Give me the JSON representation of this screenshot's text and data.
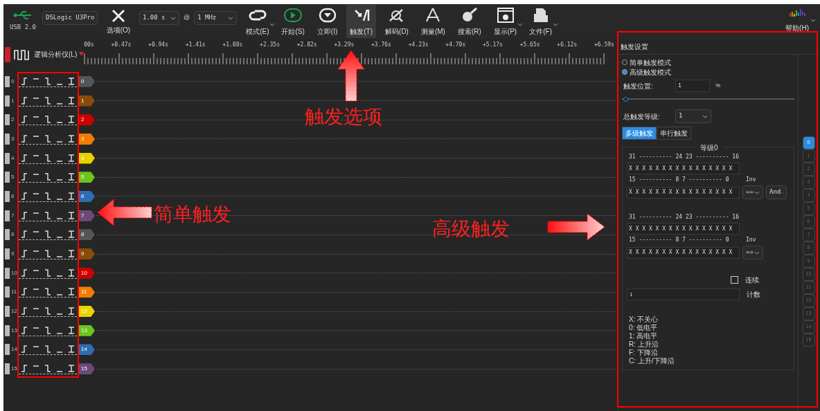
{
  "toolbar": {
    "usb_label": "USB 2.0",
    "device": "DSLogic U3Pro",
    "duration": "1.00 s",
    "at": "@",
    "rate": "1 MHz",
    "buttons": [
      {
        "kind": "options",
        "label": "选项(O)",
        "selected": false
      },
      {
        "kind": "mode",
        "label": "模式(E)",
        "selected": false,
        "menu": true
      },
      {
        "kind": "start",
        "label": "开始(S)",
        "selected": false
      },
      {
        "kind": "instant",
        "label": "立即(I)",
        "selected": false
      },
      {
        "kind": "trigger",
        "label": "触发(T)",
        "selected": true
      },
      {
        "kind": "decode",
        "label": "解码(D)",
        "selected": false
      },
      {
        "kind": "measure",
        "label": "测量(M)",
        "selected": false
      },
      {
        "kind": "search",
        "label": "搜索(R)",
        "selected": false
      },
      {
        "kind": "display",
        "label": "显示(P)",
        "selected": false,
        "menu": true
      },
      {
        "kind": "file",
        "label": "文件(F)",
        "selected": false,
        "menu": true
      }
    ],
    "help": {
      "label": "帮助(H)"
    }
  },
  "ruler": {
    "title": "逻辑分析仪(L)",
    "ticks": [
      "00s",
      "+0.47s",
      "+0.94s",
      "+1.41s",
      "+1.88s",
      "+2.35s",
      "+2.82s",
      "+3.29s",
      "+3.76s",
      "+4.23s",
      "+4.70s",
      "+5.17s",
      "+5.65s",
      "+6.12s",
      "+6.59s"
    ]
  },
  "channels": [
    {
      "index": "0",
      "tag": "0",
      "color": "#555555"
    },
    {
      "index": "1",
      "tag": "1",
      "color": "#8a4b08"
    },
    {
      "index": "2",
      "tag": "2",
      "color": "#cc0000"
    },
    {
      "index": "3",
      "tag": "3",
      "color": "#f27c00"
    },
    {
      "index": "4",
      "tag": "4",
      "color": "#e8d300"
    },
    {
      "index": "5",
      "tag": "5",
      "color": "#6cc51c"
    },
    {
      "index": "6",
      "tag": "6",
      "color": "#2e6db4"
    },
    {
      "index": "7",
      "tag": "7",
      "color": "#6b4a7a"
    },
    {
      "index": "8",
      "tag": "8",
      "color": "#555555"
    },
    {
      "index": "9",
      "tag": "9",
      "color": "#8a4b08"
    },
    {
      "index": "10",
      "tag": "10",
      "color": "#cc0000"
    },
    {
      "index": "11",
      "tag": "11",
      "color": "#f27c00"
    },
    {
      "index": "12",
      "tag": "12",
      "color": "#e8d300"
    },
    {
      "index": "13",
      "tag": "13",
      "color": "#6cc51c"
    },
    {
      "index": "14",
      "tag": "14",
      "color": "#2e6db4"
    },
    {
      "index": "15",
      "tag": "15",
      "color": "#6b4a7a"
    }
  ],
  "trigger_panel": {
    "title": "触发设置",
    "modes": [
      {
        "label": "简单触发模式",
        "selected": false
      },
      {
        "label": "高级触发模式",
        "selected": true
      }
    ],
    "position_label": "触发位置:",
    "position_value": "1",
    "position_unit": "%",
    "position_slider": {
      "level": 0.01
    },
    "stages_label": "总触发等级:",
    "stages_value": "1",
    "tabs": [
      {
        "label": "多级触发",
        "selected": true
      },
      {
        "label": "串行触发",
        "selected": false
      }
    ],
    "stage_title": "等级0",
    "conditions": [
      {
        "high_bits": "31 ---------- 24 23 ---------- 16",
        "high_value": "X X X X X X X X X X X X X X X X",
        "low_bits": "15 ---------- 8 7 ---------- 0",
        "inv_label": "Inv",
        "low_value": "X X X X X X X X X X X X X X X X",
        "compare": "==",
        "logic": "And"
      },
      {
        "high_bits": "31 ---------- 24 23 ---------- 16",
        "high_value": "X X X X X X X X X X X X X X X X",
        "low_bits": "15 ---------- 8 7 ---------- 0",
        "inv_label": "Inv",
        "low_value": "X X X X X X X X X X X X X X X X",
        "compare": "=="
      }
    ],
    "continuous": {
      "label": "连续",
      "checked": false
    },
    "count_value": "1",
    "count_label": "计数",
    "legend": [
      "X: 不关心",
      "0: 低电平",
      "1: 高电平",
      "R: 上升沿",
      "F: 下降沿",
      "C: 上升/下降沿"
    ],
    "stage_tabs": [
      {
        "label": "0",
        "selected": true
      },
      {
        "label": "1",
        "selected": false
      },
      {
        "label": "2",
        "selected": false
      },
      {
        "label": "3",
        "selected": false
      },
      {
        "label": "4",
        "selected": false
      },
      {
        "label": "5",
        "selected": false
      },
      {
        "label": "6",
        "selected": false
      },
      {
        "label": "7",
        "selected": false
      },
      {
        "label": "8",
        "selected": false
      },
      {
        "label": "9",
        "selected": false
      },
      {
        "label": "10",
        "selected": false
      },
      {
        "label": "11",
        "selected": false
      },
      {
        "label": "12",
        "selected": false
      },
      {
        "label": "13",
        "selected": false
      },
      {
        "label": "14",
        "selected": false
      },
      {
        "label": "15",
        "selected": false
      }
    ]
  },
  "annotations": [
    {
      "kind": "up",
      "label": "触发选项"
    },
    {
      "kind": "left",
      "label": "简单触发"
    },
    {
      "kind": "right",
      "label": "高级触发"
    }
  ]
}
